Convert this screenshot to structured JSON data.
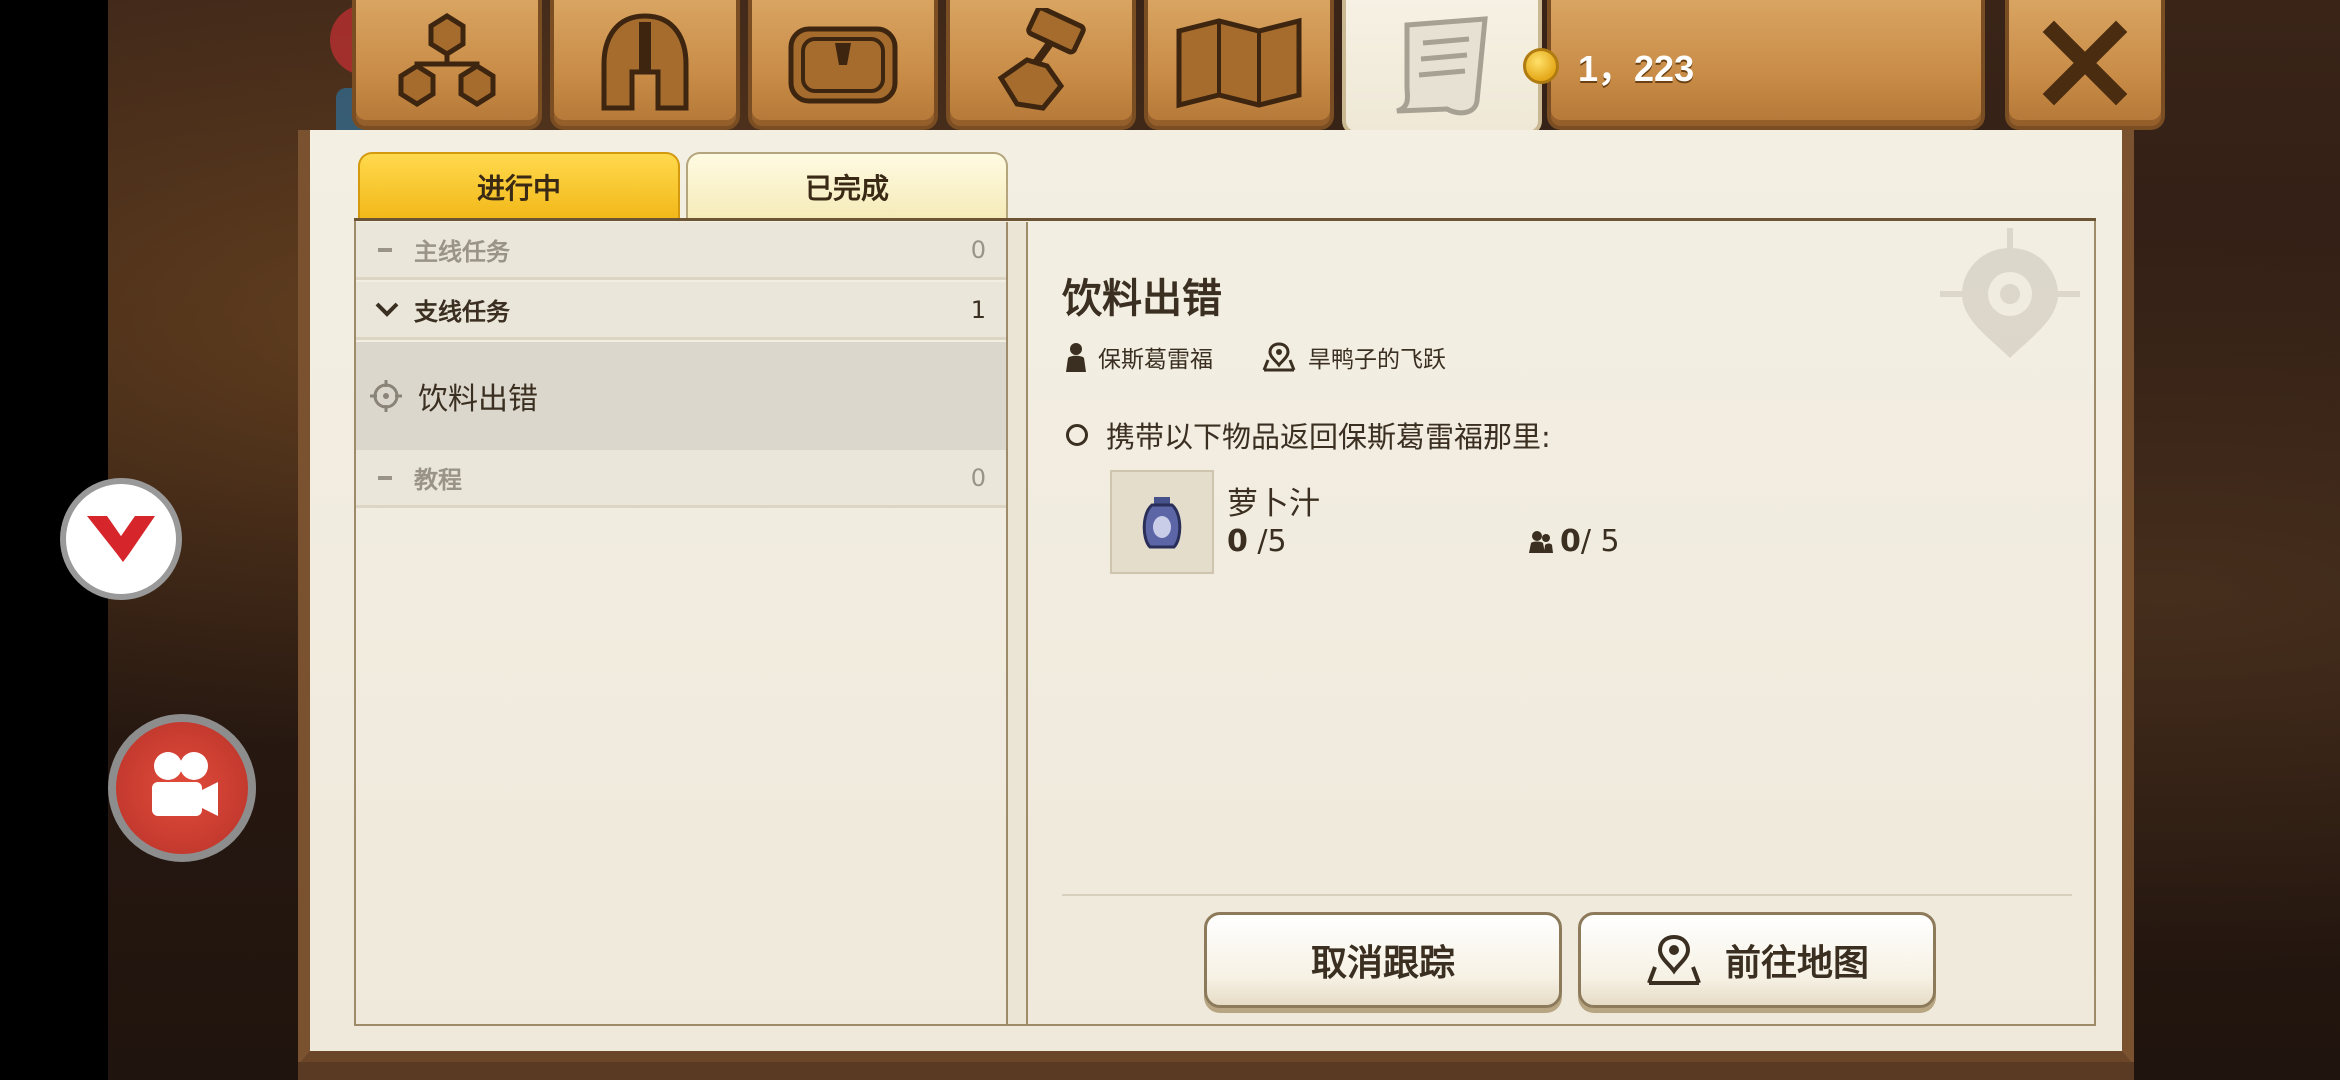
{
  "header": {
    "tabs": [
      {
        "name": "skill-tree",
        "active": false
      },
      {
        "name": "helmet",
        "active": false
      },
      {
        "name": "bag",
        "active": false
      },
      {
        "name": "crafting",
        "active": false
      },
      {
        "name": "map",
        "active": false
      },
      {
        "name": "quest-scroll",
        "active": true
      }
    ],
    "coins": "1，223",
    "close_icon": "close-x-icon"
  },
  "subtabs": {
    "in_progress": "进行中",
    "completed": "已完成"
  },
  "quest_list": {
    "main": {
      "label": "主线任务",
      "count": "0"
    },
    "side": {
      "label": "支线任务",
      "count": "1"
    },
    "selected_quest": "饮料出错",
    "tutorial": {
      "label": "教程",
      "count": "0"
    }
  },
  "detail": {
    "title": "饮料出错",
    "npc": "保斯葛雷福",
    "location": "旱鸭子的飞跃",
    "objective": "携带以下物品返回保斯葛雷福那里:",
    "item": {
      "name": "萝卜汁",
      "have": "0",
      "need": " /5",
      "party_have": "0",
      "party_need": " / 5"
    },
    "buttons": {
      "untrack": "取消跟踪",
      "go_map": "前往地图"
    }
  },
  "colors": {
    "active_subtab": "#f2b818",
    "panel_bg": "#f3efe3",
    "tab_wood": "#c88c47",
    "text_dark": "#3a2f20"
  }
}
